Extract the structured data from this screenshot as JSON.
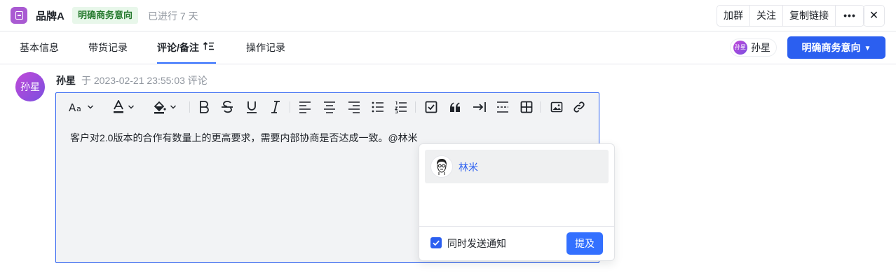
{
  "header": {
    "title": "品牌A",
    "status_tag": "明确商务意向",
    "progress_text": "已进行 7 天",
    "actions": [
      "加群",
      "关注",
      "复制链接"
    ],
    "more_label": "•••",
    "close_label": "✕"
  },
  "tabs": [
    {
      "label": "基本信息",
      "active": false
    },
    {
      "label": "带货记录",
      "active": false
    },
    {
      "label": "评论/备注",
      "active": true
    },
    {
      "label": "操作记录",
      "active": false
    }
  ],
  "owner": {
    "avatar_text": "孙星",
    "name": "孙星"
  },
  "primary_action": {
    "label": "明确商务意向",
    "caret": "▼"
  },
  "comment": {
    "avatar_text": "孙星",
    "author": "孙星",
    "meta": "于 2023-02-21 23:55:03 评论",
    "content": "客户对2.0版本的合作有数量上的更高要求，需要内部协商是否达成一致。@林米"
  },
  "toolbar": {
    "icons": [
      "font-size-icon",
      "text-color-icon",
      "highlight-icon",
      "bold-icon",
      "strikethrough-icon",
      "underline-icon",
      "italic-icon",
      "align-left-icon",
      "align-center-icon",
      "align-right-icon",
      "bullet-list-icon",
      "numbered-list-icon",
      "checkbox-icon",
      "quote-icon",
      "indent-icon",
      "divider-icon",
      "table-icon",
      "image-icon",
      "link-icon"
    ]
  },
  "mention_popup": {
    "users": [
      {
        "name": "林米"
      }
    ],
    "notify_label": "同时发送通知",
    "notify_checked": true,
    "submit_label": "提及"
  },
  "colors": {
    "primary": "#2b5ff0",
    "tag_bg": "#e8f7ea",
    "tag_text": "#267a2e",
    "avatar": "#9b4ddf"
  }
}
